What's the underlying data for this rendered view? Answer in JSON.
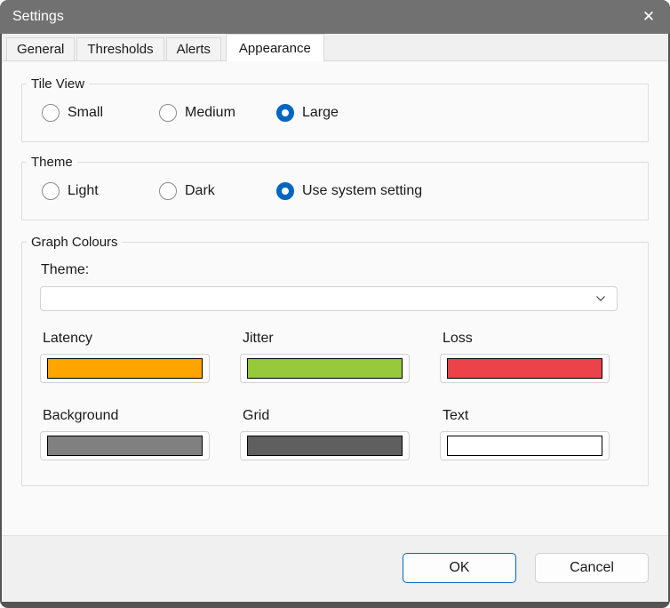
{
  "window": {
    "title": "Settings",
    "close_icon": "✕"
  },
  "tabs": [
    {
      "label": "General",
      "selected": false
    },
    {
      "label": "Thresholds",
      "selected": false
    },
    {
      "label": "Alerts",
      "selected": false
    },
    {
      "label": "Appearance",
      "selected": true
    }
  ],
  "tile_view": {
    "legend": "Tile View",
    "options": [
      {
        "label": "Small",
        "selected": false
      },
      {
        "label": "Medium",
        "selected": false
      },
      {
        "label": "Large",
        "selected": true
      }
    ]
  },
  "theme": {
    "legend": "Theme",
    "options": [
      {
        "label": "Light",
        "selected": false
      },
      {
        "label": "Dark",
        "selected": false
      },
      {
        "label": "Use system setting",
        "selected": true
      }
    ]
  },
  "graph_colours": {
    "legend": "Graph Colours",
    "theme_label": "Theme:",
    "theme_value": "",
    "swatches": [
      {
        "label": "Latency",
        "color": "#FFA500"
      },
      {
        "label": "Jitter",
        "color": "#97CA3B"
      },
      {
        "label": "Loss",
        "color": "#EC434B"
      },
      {
        "label": "Background",
        "color": "#808080"
      },
      {
        "label": "Grid",
        "color": "#5F5F5F"
      },
      {
        "label": "Text",
        "color": "#FFFFFF"
      }
    ]
  },
  "footer": {
    "ok_label": "OK",
    "cancel_label": "Cancel"
  },
  "colors": {
    "accent": "#0067C0",
    "titlebar": "#717171"
  }
}
